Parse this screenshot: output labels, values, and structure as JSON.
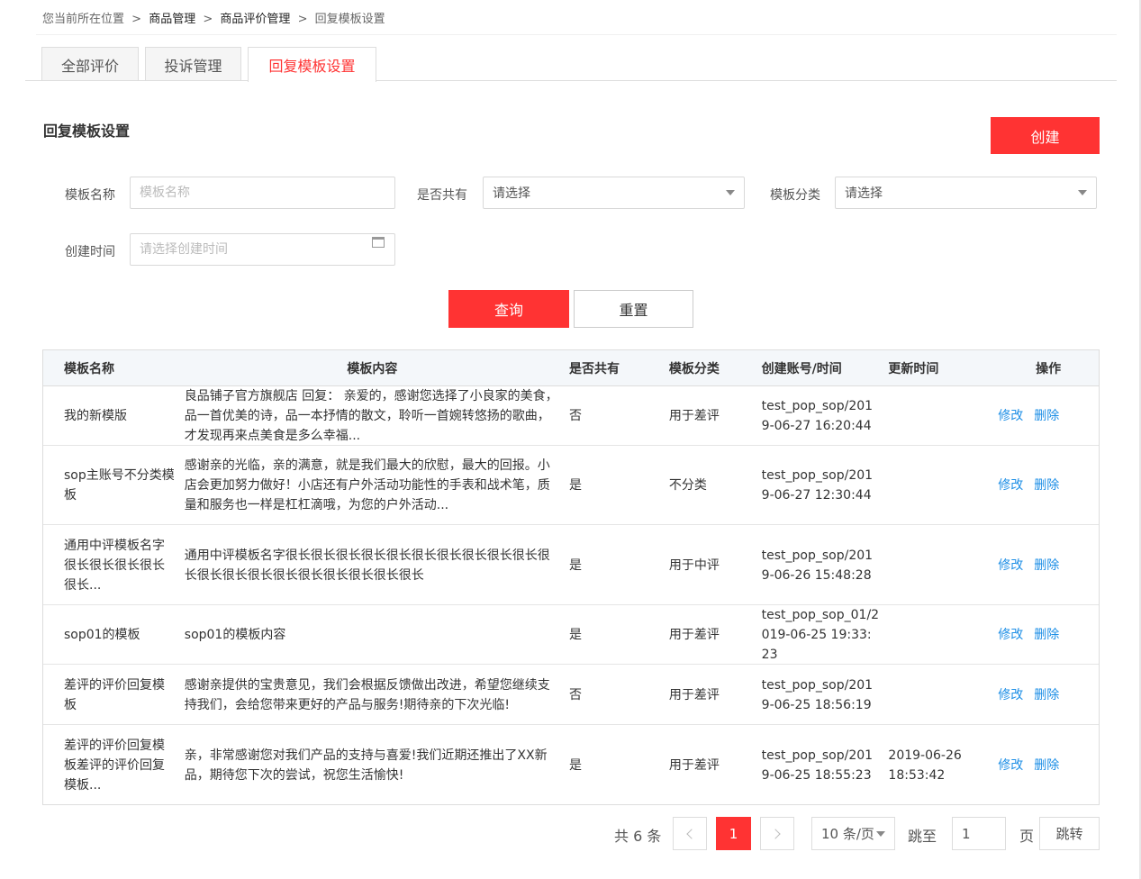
{
  "breadcrumb": {
    "prefix": "您当前所在位置",
    "items": [
      "商品管理",
      "商品评价管理"
    ],
    "current": "回复模板设置",
    "separator": ">"
  },
  "tabs": [
    {
      "label": "全部评价",
      "active": false
    },
    {
      "label": "投诉管理",
      "active": false
    },
    {
      "label": "回复模板设置",
      "active": true
    }
  ],
  "section": {
    "title": "回复模板设置",
    "create_label": "创建"
  },
  "filters": {
    "template_name": {
      "label": "模板名称",
      "placeholder": "模板名称",
      "value": ""
    },
    "shared": {
      "label": "是否共有",
      "value": "请选择"
    },
    "category": {
      "label": "模板分类",
      "value": "请选择"
    },
    "created_time": {
      "label": "创建时间",
      "placeholder": "请选择创建时间",
      "value": ""
    },
    "query_label": "查询",
    "reset_label": "重置"
  },
  "table": {
    "headers": [
      "模板名称",
      "模板内容",
      "是否共有",
      "模板分类",
      "创建账号/时间",
      "更新时间",
      "操作"
    ],
    "edit_label": "修改",
    "delete_label": "删除",
    "rows": [
      {
        "name": "我的新模版",
        "content": "良品铺子官方旗舰店 回复： 亲爱的，感谢您选择了小良家的美食，品一首优美的诗，品一本抒情的散文，聆听一首婉转悠扬的歌曲，才发现再来点美食是多么幸福...",
        "shared": "否",
        "category": "用于差评",
        "creator": "test_pop_sop/2019-06-27 16:20:44",
        "updated": ""
      },
      {
        "name": "sop主账号不分类模板",
        "content": "感谢亲的光临，亲的满意，就是我们最大的欣慰，最大的回报。小店会更加努力做好！小店还有户外活动功能性的手表和战术笔，质量和服务也一样是杠杠滴哦，为您的户外活动...",
        "shared": "是",
        "category": "不分类",
        "creator": "test_pop_sop/2019-06-27 12:30:44",
        "updated": ""
      },
      {
        "name": "通用中评模板名字很长很长很长很长很长...",
        "content": "通用中评模板名字很长很长很长很长很长很长很长很长很长很长很长很长很长很长很长很长很长很长很长很长",
        "shared": "是",
        "category": "用于中评",
        "creator": "test_pop_sop/2019-06-26 15:48:28",
        "updated": ""
      },
      {
        "name": "sop01的模板",
        "content": "sop01的模板内容",
        "shared": "是",
        "category": "用于差评",
        "creator": "test_pop_sop_01/2019-06-25 19:33:23",
        "updated": ""
      },
      {
        "name": "差评的评价回复模板",
        "content": "感谢亲提供的宝贵意见，我们会根据反馈做出改进，希望您继续支持我们，会给您带来更好的产品与服务!期待亲的下次光临!",
        "shared": "否",
        "category": "用于差评",
        "creator": "test_pop_sop/2019-06-25 18:56:19",
        "updated": ""
      },
      {
        "name": "差评的评价回复模板差评的评价回复模板...",
        "content": "亲，非常感谢您对我们产品的支持与喜爱!我们近期还推出了XX新品，期待您下次的尝试，祝您生活愉快!",
        "shared": "是",
        "category": "用于差评",
        "creator": "test_pop_sop/2019-06-25 18:55:23",
        "updated": "2019-06-26 18:53:42"
      }
    ]
  },
  "pagination": {
    "total_text": "共 6 条",
    "current_page": "1",
    "page_size": "10 条/页",
    "jump_label": "跳至",
    "jump_value": "1",
    "page_suffix": "页",
    "jump_button": "跳转"
  },
  "colors": {
    "accent": "#ff3333",
    "link": "#1e8fe6",
    "header_bg": "#f4f7fa"
  }
}
